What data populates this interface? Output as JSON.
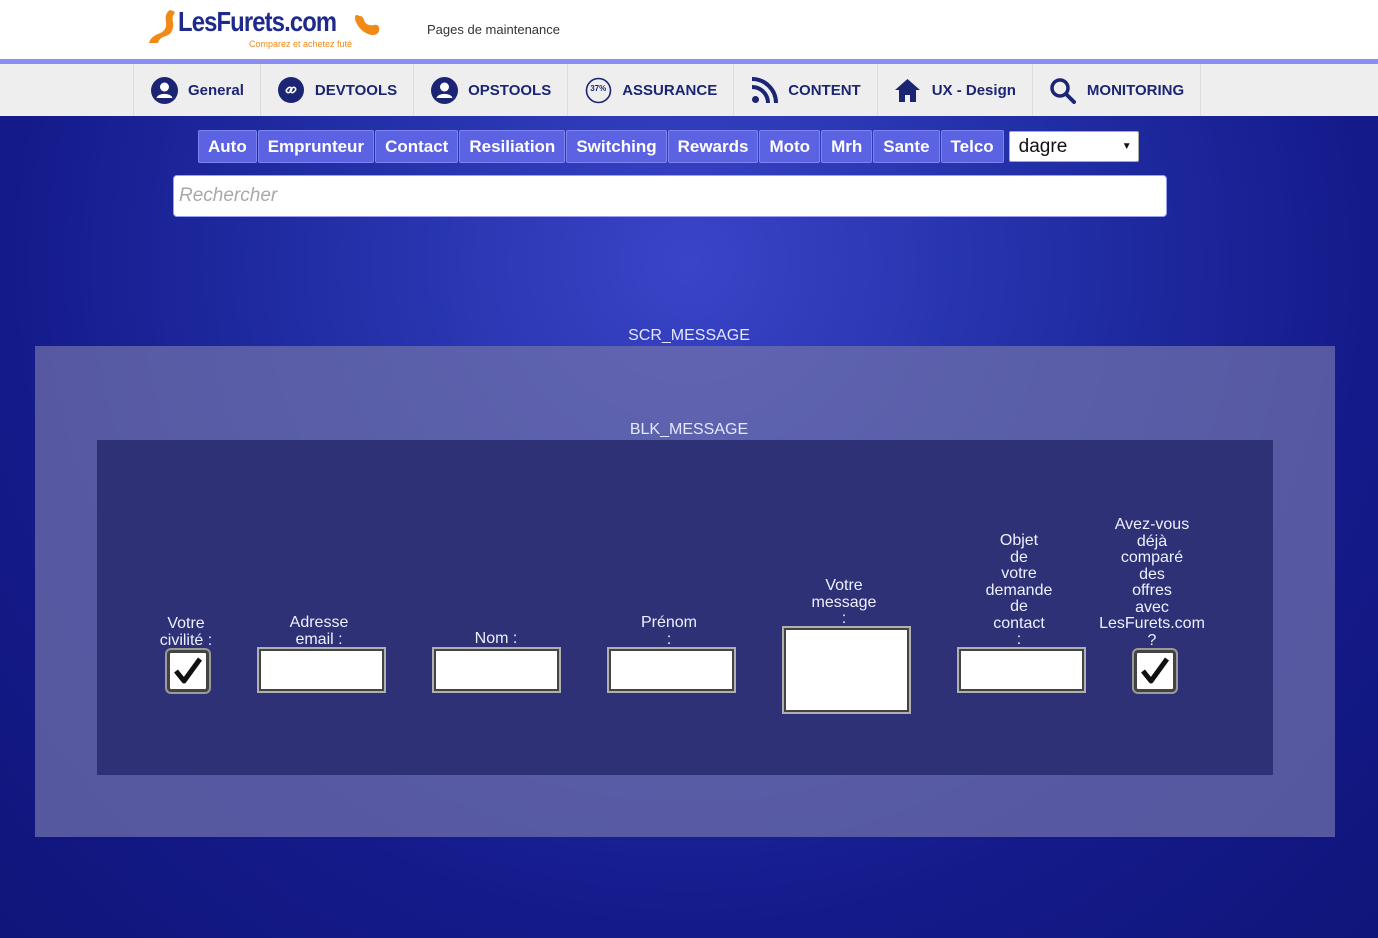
{
  "header": {
    "logo_text": "LesFurets.com",
    "logo_tagline": "Comparez et achetez futé",
    "site_subtitle": "Pages de maintenance"
  },
  "nav": {
    "items": [
      {
        "label": "General",
        "icon": "user-icon"
      },
      {
        "label": "DEVTOOLS",
        "icon": "link-icon"
      },
      {
        "label": "OPSTOOLS",
        "icon": "user-icon"
      },
      {
        "label": "ASSURANCE",
        "icon": "percent-badge-icon",
        "badge": "37%"
      },
      {
        "label": "CONTENT",
        "icon": "rss-icon"
      },
      {
        "label": "UX - Design",
        "icon": "home-icon"
      },
      {
        "label": "MONITORING",
        "icon": "search-icon"
      }
    ]
  },
  "filters": {
    "tabs": [
      "Auto",
      "Emprunteur",
      "Contact",
      "Resiliation",
      "Switching",
      "Rewards",
      "Moto",
      "Mrh",
      "Sante",
      "Telco"
    ],
    "select_value": "dagre"
  },
  "search": {
    "placeholder": "Rechercher",
    "value": ""
  },
  "screen": {
    "scr_label": "SCR_MESSAGE",
    "blk_label": "BLK_MESSAGE",
    "fields": [
      {
        "label": "Votre\ncivilité :",
        "type": "checkbox",
        "checked": true
      },
      {
        "label": "Adresse\nemail :",
        "type": "text"
      },
      {
        "label": "Nom :",
        "type": "text"
      },
      {
        "label": "Prénom\n:",
        "type": "text"
      },
      {
        "label": "Votre\nmessage\n:",
        "type": "textarea"
      },
      {
        "label": "Objet\nde\nvotre\ndemande\nde\ncontact\n:",
        "type": "text"
      },
      {
        "label": "Avez-vous\ndéjà\ncomparé\ndes\noffres\navec\nLesFurets.com\n?",
        "type": "checkbox",
        "checked": true
      }
    ]
  },
  "colors": {
    "nav_text": "#1b2574",
    "tab_bg": "#5b63e3",
    "accent_line": "#8a8ef2",
    "logo_orange": "#f08a16",
    "logo_blue": "#1e2a8c"
  }
}
